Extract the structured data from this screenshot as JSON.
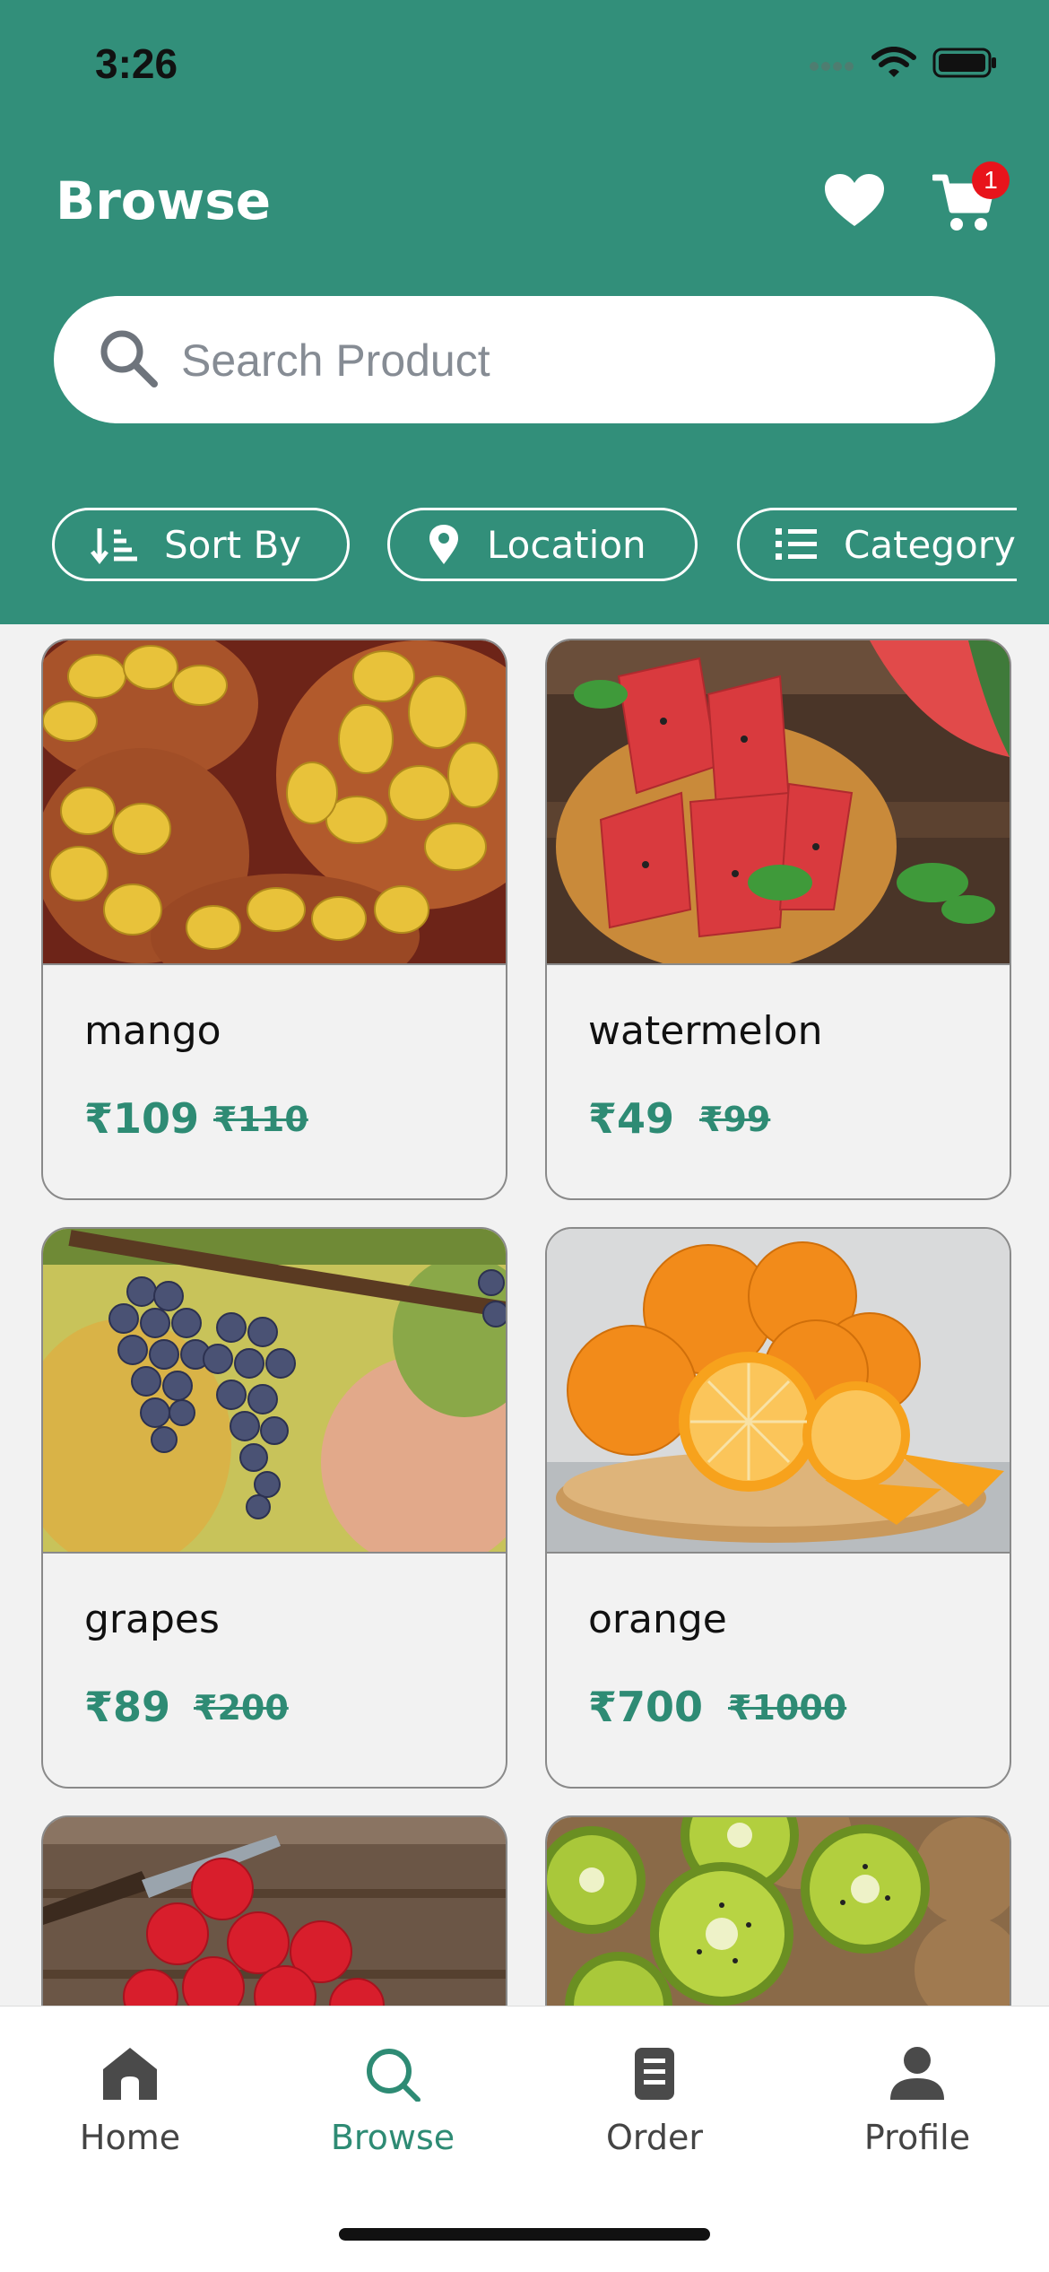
{
  "status_bar": {
    "time": "3:26"
  },
  "header": {
    "title": "Browse",
    "cart_count": "1"
  },
  "search": {
    "placeholder": "Search Product"
  },
  "chips": [
    {
      "label": "Sort By",
      "icon": "sort-icon"
    },
    {
      "label": "Location",
      "icon": "location-pin-icon"
    },
    {
      "label": "Category",
      "icon": "list-icon"
    }
  ],
  "products": [
    {
      "name": "mango",
      "price": "₹109",
      "old_price": "₹110",
      "image": "mango-baskets"
    },
    {
      "name": "watermelon",
      "price": "₹49",
      "old_price": "₹99",
      "image": "watermelon-slices"
    },
    {
      "name": "grapes",
      "price": "₹89",
      "old_price": "₹200",
      "image": "grape-bunches"
    },
    {
      "name": "orange",
      "price": "₹700",
      "old_price": "₹1000",
      "image": "oranges-on-board"
    },
    {
      "name": "",
      "price": "",
      "old_price": "",
      "image": "apples-with-knife"
    },
    {
      "name": "",
      "price": "",
      "old_price": "",
      "image": "kiwi-halves"
    }
  ],
  "tabs": [
    {
      "label": "Home",
      "icon": "home-icon",
      "active": false
    },
    {
      "label": "Browse",
      "icon": "search-icon",
      "active": true
    },
    {
      "label": "Order",
      "icon": "document-icon",
      "active": false
    },
    {
      "label": "Profile",
      "icon": "person-icon",
      "active": false
    }
  ],
  "colors": {
    "brand": "#328f7a",
    "price": "#2e8b74",
    "badge": "#e8141b"
  }
}
